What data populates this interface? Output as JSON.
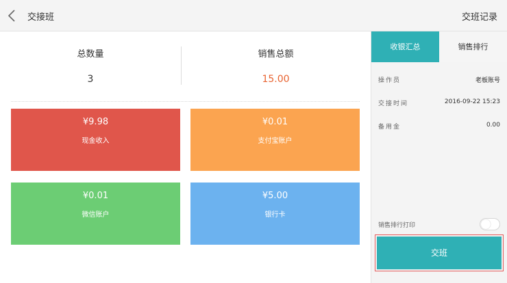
{
  "header": {
    "back_icon": "chevron-left-icon",
    "title": "交接班",
    "records_link": "交班记录"
  },
  "summary": {
    "quantity_label": "总数量",
    "quantity_value": "3",
    "sales_label": "销售总额",
    "sales_value": "15.00",
    "sales_color": "#e8622f"
  },
  "payments": [
    {
      "amount": "¥9.98",
      "label": "现金收入",
      "color": "#e0564b"
    },
    {
      "amount": "¥0.01",
      "label": "支付宝账户",
      "color": "#fba450"
    },
    {
      "amount": "¥0.01",
      "label": "微信账户",
      "color": "#6ccd74"
    },
    {
      "amount": "¥5.00",
      "label": "银行卡",
      "color": "#6cb2ef"
    }
  ],
  "panel": {
    "tabs": [
      {
        "label": "收银汇总",
        "active": true
      },
      {
        "label": "销售排行",
        "active": false
      }
    ],
    "info": [
      {
        "key": "操作员",
        "value": "老板账号"
      },
      {
        "key": "交接时间",
        "value": "2016-09-22 15:23"
      },
      {
        "key": "备用金",
        "value": "0.00"
      }
    ],
    "print_ranking_label": "销售排行打印",
    "print_ranking_enabled": false,
    "handover_button": "交班",
    "accent_color": "#2fb0b5"
  }
}
